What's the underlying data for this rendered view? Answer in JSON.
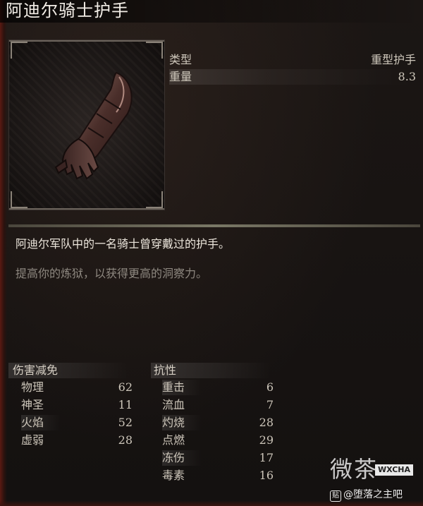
{
  "item": {
    "name": "阿迪尔骑士护手",
    "properties": [
      {
        "label": "类型",
        "value": "重型护手"
      },
      {
        "label": "重量",
        "value": "8.3"
      }
    ],
    "description": "阿迪尔军队中的一名骑士曾穿戴过的护手。",
    "effect": "提高你的炼狱，以获得更高的洞察力。"
  },
  "damage_reduction": {
    "header": "伤害减免",
    "rows": [
      {
        "label": "物理",
        "value": "62"
      },
      {
        "label": "神圣",
        "value": "11"
      },
      {
        "label": "火焰",
        "value": "52"
      },
      {
        "label": "虚弱",
        "value": "28"
      }
    ]
  },
  "resistance": {
    "header": "抗性",
    "rows": [
      {
        "label": "重击",
        "value": "6"
      },
      {
        "label": "流血",
        "value": "7"
      },
      {
        "label": "灼烧",
        "value": "28"
      },
      {
        "label": "点燃",
        "value": "29"
      },
      {
        "label": "冻伤",
        "value": "17"
      },
      {
        "label": "毒素",
        "value": "16"
      }
    ]
  },
  "watermark": {
    "big_text": "微茶",
    "badge": "WXCHA",
    "tie_icon": "贴",
    "forum": "@堕落之主吧"
  },
  "colors": {
    "frame_red": "#5b1a12",
    "text_main": "#d8d0c2",
    "text_muted": "#8e8880"
  }
}
